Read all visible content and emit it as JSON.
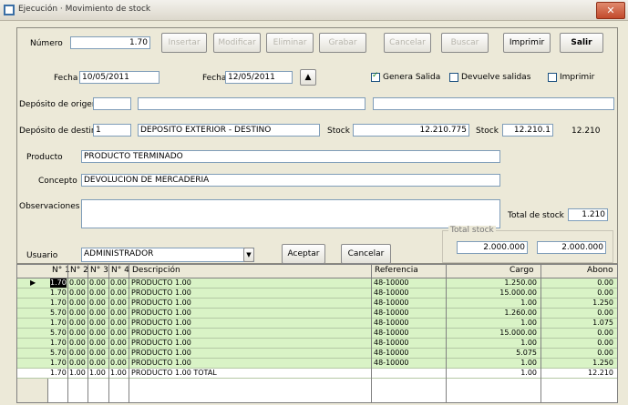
{
  "window": {
    "title": "Ejecución · Movimiento de stock"
  },
  "toolbar": {
    "numero_label": "Número",
    "numero_value": "1.70",
    "buttons": [
      "Insertar",
      "Modificar",
      "Eliminar",
      "Grabar",
      "Cancelar",
      "Buscar",
      "Imprimir",
      "Salir"
    ]
  },
  "form": {
    "fecha_label": "Fecha",
    "fecha_value": "10/05/2011",
    "fecha2_label": "Fecha",
    "fecha2_value": "12/05/2011",
    "chk1_label": "Genera Salida",
    "chk2_label": "Devuelve salidas",
    "chk3_label": "Imprimir",
    "deposito_origen_label": "Depósito de origen",
    "deposito_destino_label": "Depósito de destino",
    "deposito_destino_code": "1",
    "deposito_destino_name": "DEPOSITO EXTERIOR - DESTINO",
    "stock_label": "Stock",
    "stock_value": "12.210.775",
    "stock2_label": "Stock",
    "stock2_value": "12.210.1",
    "stock2_right": "12.210",
    "producto_label": "Producto",
    "producto_value": "PRODUCTO TERMINADO",
    "concepto_label": "Concepto",
    "concepto_value": "DEVOLUCION DE MERCADERIA",
    "observaciones_label": "Observaciones",
    "total_label": "Total de stock",
    "total_value": "1.210",
    "usuario_label": "Usuario",
    "usuario_value": "ADMINISTRADOR",
    "btn_ok": "Aceptar",
    "btn_cancel": "Cancelar",
    "group_label": "Total stock",
    "group_v1": "2.000.000",
    "group_v2": "2.000.000"
  },
  "grid": {
    "columns": [
      "N° 1",
      "N° 2",
      "N° 3",
      "N° 4",
      "Descripción",
      "Referencia",
      "Cargo",
      "Abono"
    ],
    "rows": [
      [
        "1.70",
        "0.00",
        "0.00",
        "0.00",
        "PRODUCTO 1.00",
        "48-10000",
        "1.250.00",
        "0.00"
      ],
      [
        "1.70",
        "0.00",
        "0.00",
        "0.00",
        "PRODUCTO 1.00",
        "48-10000",
        "15.000.00",
        "0.00"
      ],
      [
        "1.70",
        "0.00",
        "0.00",
        "0.00",
        "PRODUCTO 1.00",
        "48-10000",
        "1.00",
        "1.250"
      ],
      [
        "5.70",
        "0.00",
        "0.00",
        "0.00",
        "PRODUCTO 1.00",
        "48-10000",
        "1.260.00",
        "0.00"
      ],
      [
        "1.70",
        "0.00",
        "0.00",
        "0.00",
        "PRODUCTO 1.00",
        "48-10000",
        "1.00",
        "1.075"
      ],
      [
        "5.70",
        "0.00",
        "0.00",
        "0.00",
        "PRODUCTO 1.00",
        "48-10000",
        "15.000.00",
        "0.00"
      ],
      [
        "1.70",
        "0.00",
        "0.00",
        "0.00",
        "PRODUCTO 1.00",
        "48-10000",
        "1.00",
        "0.00"
      ],
      [
        "5.70",
        "0.00",
        "0.00",
        "0.00",
        "PRODUCTO 1.00",
        "48-10000",
        "5.075",
        "0.00"
      ],
      [
        "1.70",
        "0.00",
        "0.00",
        "0.00",
        "PRODUCTO 1.00",
        "48-10000",
        "1.00",
        "1.250"
      ],
      [
        "1.70",
        "1.00",
        "1.00",
        "1.00",
        "PRODUCTO 1.00 TOTAL",
        "",
        "1.00",
        "12.210"
      ]
    ]
  }
}
